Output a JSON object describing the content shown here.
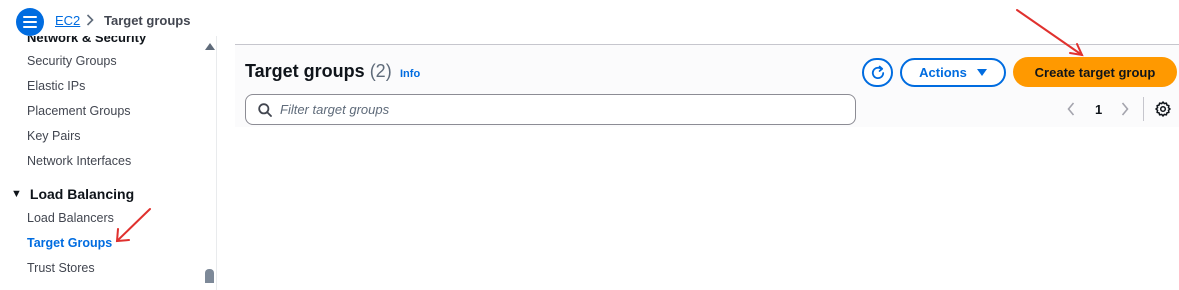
{
  "breadcrumb": {
    "home": "EC2",
    "current": "Target groups"
  },
  "sidebar": {
    "cut_heading": "Network & Security",
    "items_top": [
      "Security Groups",
      "Elastic IPs",
      "Placement Groups",
      "Key Pairs",
      "Network Interfaces"
    ],
    "section": "Load Balancing",
    "items_bottom": [
      "Load Balancers",
      "Target Groups",
      "Trust Stores"
    ],
    "active_item": "Target Groups"
  },
  "main": {
    "title": "Target groups",
    "count": "(2)",
    "info": "Info",
    "actions_label": "Actions",
    "create_label": "Create target group",
    "search_placeholder": "Filter target groups",
    "page_number": "1"
  },
  "icons": {
    "menu": "hamburger-menu-icon",
    "refresh": "refresh-icon",
    "search": "search-icon",
    "settings": "gear-icon"
  },
  "colors": {
    "link": "#006ce0",
    "primary_button": "#ff9900",
    "annotation": "#e0312e"
  }
}
